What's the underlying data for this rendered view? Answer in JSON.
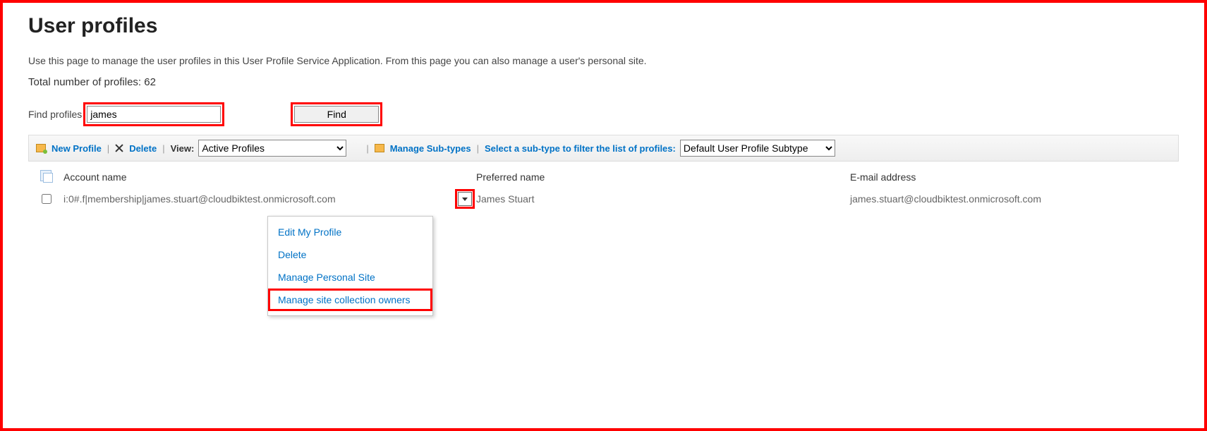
{
  "page_title": "User profiles",
  "description": "Use this page to manage the user profiles in this User Profile Service Application. From this page you can also manage a user's personal site.",
  "total_line": "Total number of profiles: 62",
  "find": {
    "label": "Find profiles",
    "value": "james",
    "button": "Find"
  },
  "toolbar": {
    "new_profile": "New Profile",
    "delete": "Delete",
    "view_label": "View:",
    "view_value": "Active Profiles",
    "manage_subtypes": "Manage Sub-types",
    "subtype_prompt": "Select a sub-type to filter the list of profiles:",
    "subtype_value": "Default User Profile Subtype"
  },
  "columns": {
    "account": "Account name",
    "preferred": "Preferred name",
    "email": "E-mail address"
  },
  "row": {
    "account": "i:0#.f|membership|james.stuart@cloudbiktest.onmicrosoft.com",
    "preferred": "James Stuart",
    "email": "james.stuart@cloudbiktest.onmicrosoft.com"
  },
  "menu": {
    "edit": "Edit My Profile",
    "delete": "Delete",
    "manage_personal": "Manage Personal Site",
    "manage_owners": "Manage site collection owners"
  }
}
